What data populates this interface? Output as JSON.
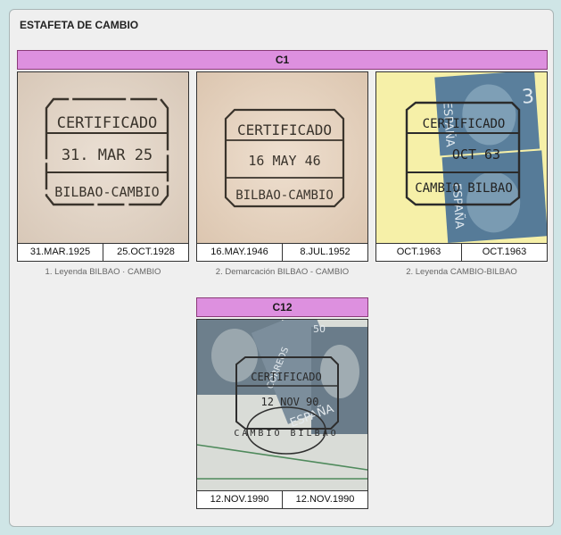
{
  "panel": {
    "title": "ESTAFETA DE CAMBIO"
  },
  "sections": [
    {
      "header": "C1",
      "cards": [
        {
          "dates": [
            "31.MAR.1925",
            "25.OCT.1928"
          ],
          "caption": "1. Leyenda BILBAO · CAMBIO",
          "postmark": {
            "top": "CERTIFICADO",
            "middle": "31. MAR 25",
            "bottom": "BILBAO-CAMBIO"
          }
        },
        {
          "dates": [
            "16.MAY.1946",
            "8.JUL.1952"
          ],
          "caption": "2. Demarcación BILBAO - CAMBIO",
          "postmark": {
            "top": "CERTIFICADO",
            "middle": "16 MAY 46",
            "bottom": "BILBAO-CAMBIO"
          }
        },
        {
          "dates": [
            "OCT.1963",
            "OCT.1963"
          ],
          "caption": "2. Leyenda CAMBIO-BILBAO",
          "postmark": {
            "top": "CERTIFICADO",
            "middle": "OCT 63",
            "bottom": "CAMBIO BILBAO"
          },
          "stamp": {
            "country": "ESPAÑA",
            "value": "3"
          }
        }
      ]
    },
    {
      "header": "C12",
      "cards": [
        {
          "dates": [
            "12.NOV.1990",
            "12.NOV.1990"
          ],
          "caption": "",
          "postmark": {
            "top": "CERTIFICADO",
            "middle": "12 NOV 90",
            "bottom": "CAMBIO BILBAO"
          },
          "stamp": {
            "country": "ESPAÑA",
            "value": "50",
            "label": "CORREOS"
          }
        }
      ]
    }
  ],
  "colors": {
    "header_bg": "#dd90df",
    "header_border": "#8a3a78",
    "page_bg": "#cfe5e6",
    "panel_bg": "#efefef"
  }
}
